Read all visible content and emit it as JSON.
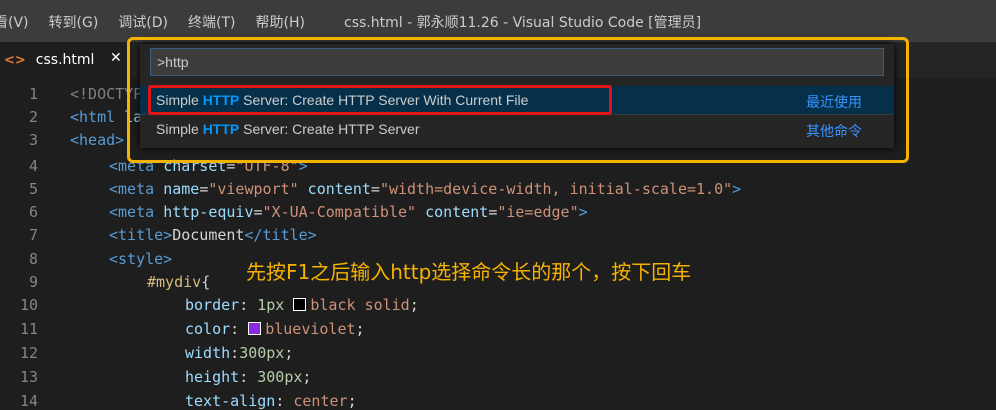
{
  "menu": [
    "看(V)",
    "转到(G)",
    "调试(D)",
    "终端(T)",
    "帮助(H)"
  ],
  "window_title": "css.html - 郭永顺11.26 - Visual Studio Code [管理员]",
  "tab": {
    "icon": "html-file-icon",
    "label": "css.html",
    "close": "✕"
  },
  "palette": {
    "query": ">http",
    "items": [
      {
        "pre": "Simple ",
        "hl": "HTTP",
        "post": " Server: Create HTTP Server With Current File",
        "tag": "最近使用"
      },
      {
        "pre": "Simple ",
        "hl": "HTTP",
        "post": " Server: Create HTTP Server",
        "tag": "其他命令"
      }
    ]
  },
  "line_numbers": [
    "1",
    "2",
    "3",
    "4",
    "5",
    "6",
    "7",
    "8",
    "9",
    "10",
    "11",
    "12",
    "13",
    "14"
  ],
  "code": {
    "l1": "<!DOCTYP",
    "l2a": "<html ",
    "l2b": "la",
    "l3": "<head>",
    "l4a": "<meta ",
    "l4b": "charset",
    "l4c": "=",
    "l4d": "\"UTF-8\"",
    "l4e": ">",
    "l5a": "<meta ",
    "l5b": "name",
    "l5c": "=",
    "l5d": "\"viewport\"",
    "l5e": " content",
    "l5f": "=",
    "l5g": "\"width=device-width, initial-scale=1.0\"",
    "l5h": ">",
    "l6a": "<meta ",
    "l6b": "http-equiv",
    "l6c": "=",
    "l6d": "\"X-UA-Compatible\"",
    "l6e": " content",
    "l6f": "=",
    "l6g": "\"ie=edge\"",
    "l6h": ">",
    "l7a": "<title>",
    "l7b": "Document",
    "l7c": "</title>",
    "l8": "<style>",
    "l9a": "#mydiv",
    "l9b": "{",
    "l10a": "border",
    "l10b": ": ",
    "l10c": "1px",
    "l10d": "black solid",
    "l10e": ";",
    "l11a": "color",
    "l11b": ": ",
    "l11c": "blueviolet",
    "l11d": ";",
    "l12a": "width",
    "l12b": ":",
    "l12c": "300px",
    "l12d": ";",
    "l13a": "height",
    "l13b": ": ",
    "l13c": "300px",
    "l13d": ";",
    "l14a": "text-align",
    "l14b": ": ",
    "l14c": "center",
    "l14d": ";"
  },
  "colors": {
    "swatch_black": "#000000",
    "swatch_blueviolet": "#8a2be2",
    "highlight_orange": "#f5b301",
    "highlight_red": "#e01616"
  },
  "annotation": "先按F1之后输入http选择命令长的那个，按下回车"
}
